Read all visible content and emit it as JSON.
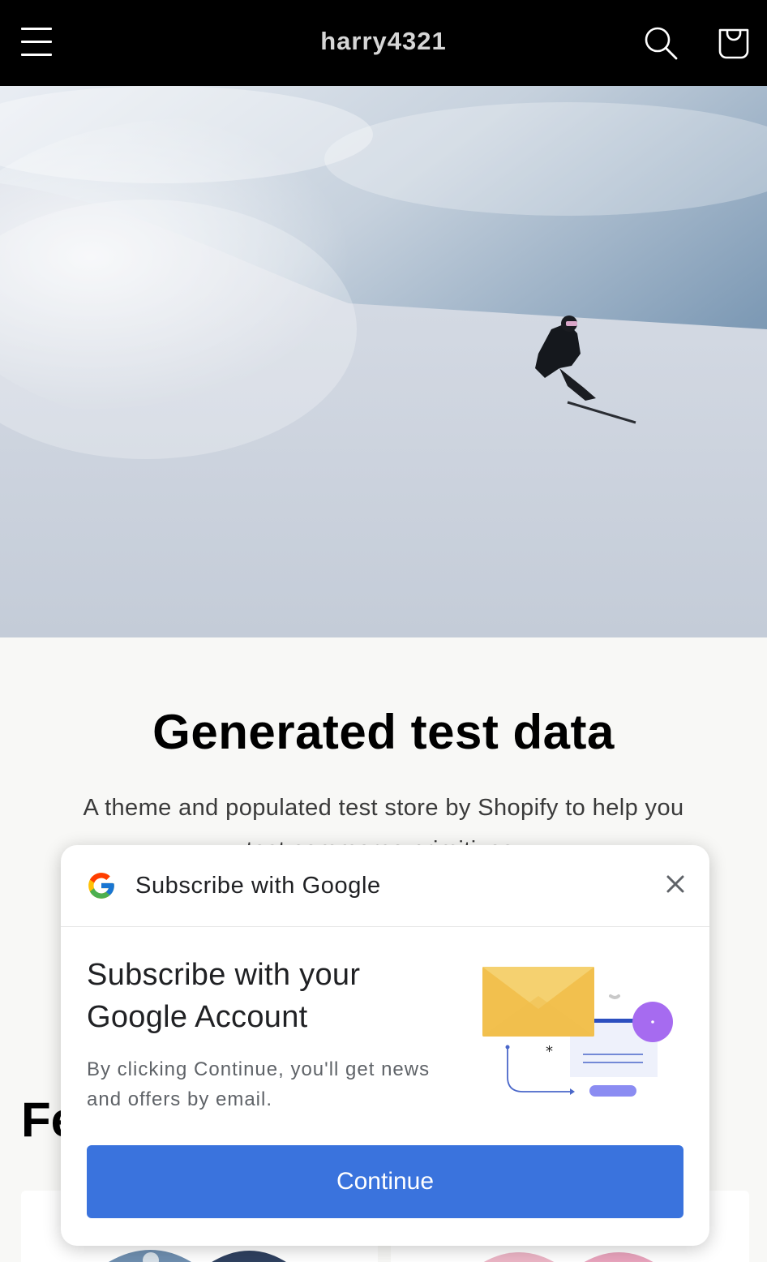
{
  "header": {
    "store_name": "harry4321"
  },
  "intro": {
    "title": "Generated test data",
    "description": "A theme and populated test store by Shopify to help you test commerce primitives."
  },
  "featured": {
    "heading": "Fe"
  },
  "subscribe_dialog": {
    "title": "Subscribe with Google",
    "heading": "Subscribe with your Google Account",
    "body": "By clicking Continue, you'll get news and offers by email.",
    "continue_label": "Continue"
  },
  "colors": {
    "header_bg": "#000000",
    "continue_button": "#3a73dd",
    "page_bg": "#f8f8f6"
  },
  "icons": [
    "menu-icon",
    "search-icon",
    "cart-icon",
    "google-logo-icon",
    "close-icon",
    "email-subscribe-illustration"
  ]
}
